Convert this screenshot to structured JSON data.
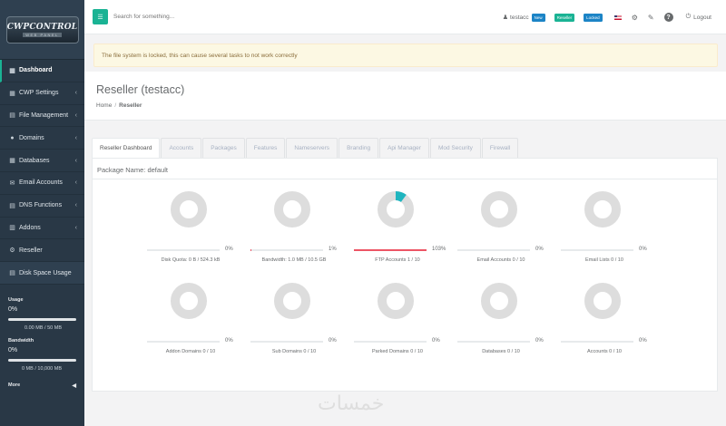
{
  "sidebar": {
    "logo": {
      "main": "CWPCONTROL",
      "sub": "WEB PANEL"
    },
    "items": [
      {
        "label": "Dashboard",
        "icon": "▦",
        "active": true,
        "caret": false
      },
      {
        "label": "CWP Settings",
        "icon": "▦",
        "active": false,
        "caret": true
      },
      {
        "label": "File Management",
        "icon": "▤",
        "active": false,
        "caret": true
      },
      {
        "label": "Domains",
        "icon": "●",
        "active": false,
        "caret": true
      },
      {
        "label": "Databases",
        "icon": "▦",
        "active": false,
        "caret": true
      },
      {
        "label": "Email Accounts",
        "icon": "✉",
        "active": false,
        "caret": true
      },
      {
        "label": "DNS Functions",
        "icon": "▤",
        "active": false,
        "caret": true
      },
      {
        "label": "Addons",
        "icon": "▥",
        "active": false,
        "caret": true
      },
      {
        "label": "Reseller",
        "icon": "⚙",
        "active": false,
        "caret": false
      },
      {
        "label": "Disk Space Usage",
        "icon": "▤",
        "active": false,
        "caret": false
      }
    ],
    "usage": {
      "title": "Usage",
      "pct": "0%",
      "text": "0.00 MB / 50 MB"
    },
    "bandwidth": {
      "title": "Bandwidth",
      "pct": "0%",
      "text": "0 MB / 10,000 MB"
    },
    "more": "More"
  },
  "topbar": {
    "search_placeholder": "Search for something...",
    "username": "testacc",
    "badges": {
      "new": "New",
      "reseller": "Reseller",
      "locked": "Locked"
    },
    "logout": "Logout"
  },
  "alert": "The file system is locked, this can cause several tasks to not work correctly",
  "page": {
    "title": "Reseller (testacc)",
    "breadcrumb": {
      "home": "Home",
      "current": "Reseller"
    }
  },
  "tabs": [
    "Reseller Dashboard",
    "Accounts",
    "Packages",
    "Features",
    "Nameservers",
    "Branding",
    "Api Manager",
    "Mod Security",
    "Firewall"
  ],
  "package_name": "Package Name: default",
  "gauges": [
    {
      "label": "Disk Quota: 0 B / 524.3 kB",
      "pct": "0%",
      "value": 0
    },
    {
      "label": "Bandwidth: 1.0 MB / 10.5 GB",
      "pct": "1%",
      "value": 1
    },
    {
      "label": "FTP Accounts 1 / 10",
      "pct": "103%",
      "value": 103
    },
    {
      "label": "Email Accounts 0 / 10",
      "pct": "0%",
      "value": 0
    },
    {
      "label": "Email Lists 0 / 10",
      "pct": "0%",
      "value": 0
    },
    {
      "label": "Addon Domains 0 / 10",
      "pct": "0%",
      "value": 0
    },
    {
      "label": "Sub Domains 0 / 10",
      "pct": "0%",
      "value": 0
    },
    {
      "label": "Parked Domains 0 / 10",
      "pct": "0%",
      "value": 0
    },
    {
      "label": "Databases 0 / 10",
      "pct": "0%",
      "value": 0
    },
    {
      "label": "Accounts 0 / 10",
      "pct": "0%",
      "value": 0
    }
  ],
  "gauge_colors": {
    "track": "#dddddd",
    "fill": "#1fb5bf",
    "bar": "#ed5565"
  },
  "watermark": "خمسات"
}
